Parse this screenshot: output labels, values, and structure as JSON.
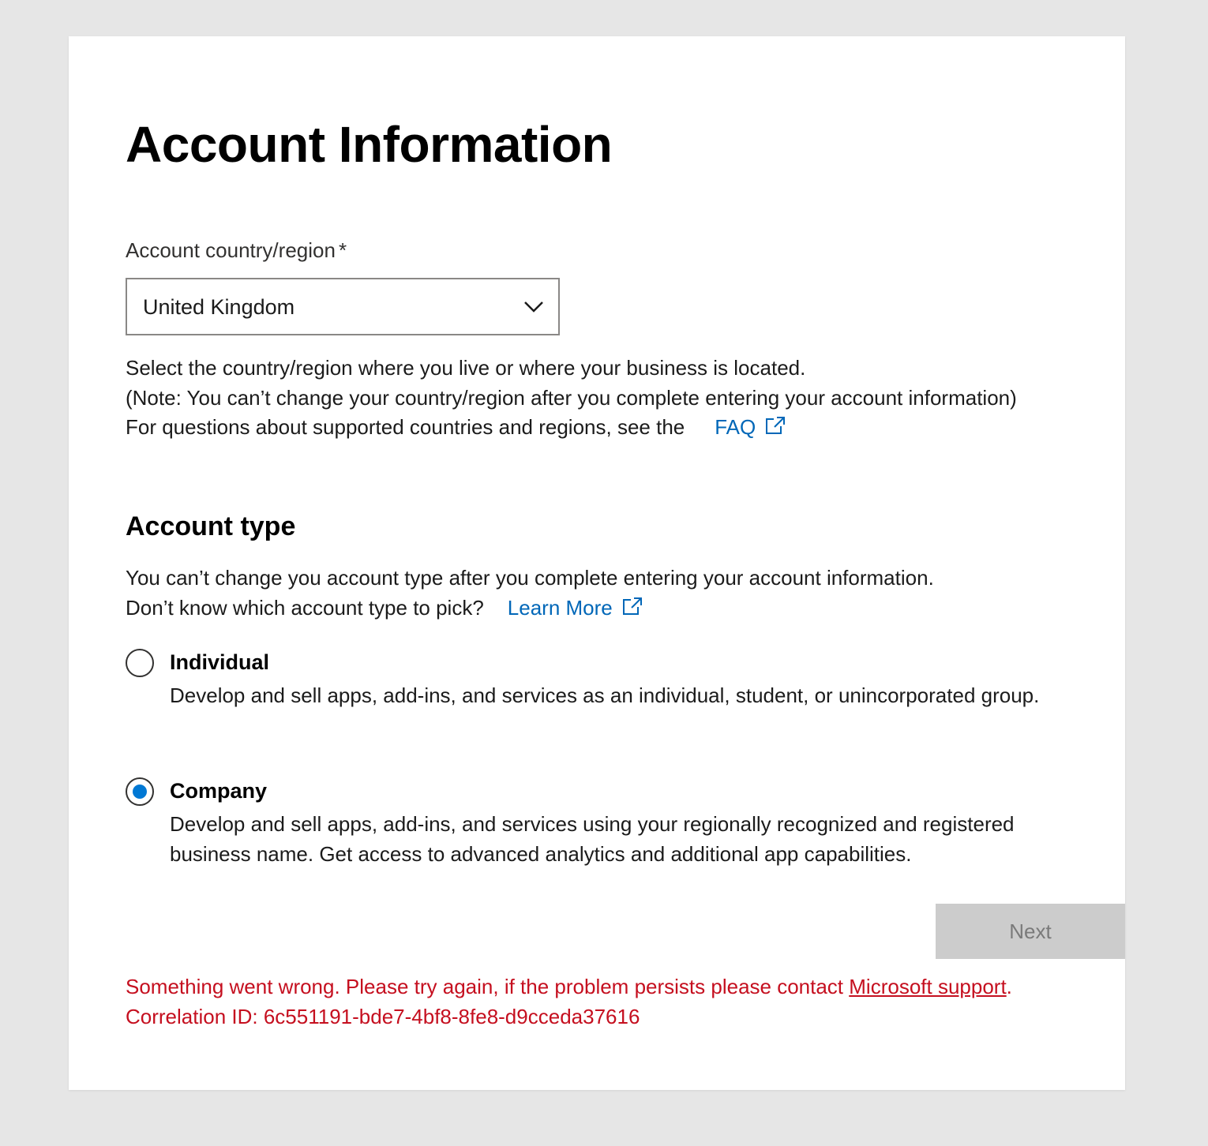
{
  "page": {
    "title": "Account Information"
  },
  "country": {
    "label": "Account country/region",
    "required_mark": "*",
    "selected_value": "United Kingdom",
    "help_line1": "Select the country/region where you live or where your business is located.",
    "help_line2": "(Note: You can’t change your country/region after you complete entering your account information)",
    "faq_prefix": "For questions about supported countries and regions, see the",
    "faq_link": "FAQ"
  },
  "account_type": {
    "heading": "Account type",
    "help_line1": "You can’t change you account type after you complete entering your account information.",
    "help_line2": "Don’t know which account type to pick?",
    "learn_more_link": "Learn More",
    "options": [
      {
        "title": "Individual",
        "description": "Develop and sell apps, add-ins, and services as an individual, student, or unincorporated group.",
        "selected": false
      },
      {
        "title": "Company",
        "description": "Develop and sell apps, add-ins, and services using your regionally recognized and registered business name. Get access to advanced analytics and additional app capabilities.",
        "selected": true
      }
    ]
  },
  "actions": {
    "next_label": "Next",
    "next_disabled": true
  },
  "error": {
    "message_prefix": "Something went wrong. Please try again, if the problem persists please contact ",
    "link_text": "Microsoft support",
    "message_suffix": ". Correlation ID: 6c551191-bde7-4bf8-8fe8-d9cceda37616"
  },
  "colors": {
    "background": "#e6e6e6",
    "link": "#0067b8",
    "radio_selected": "#0078d4",
    "error": "#c50f1f",
    "button_disabled_bg": "#cccccc",
    "button_disabled_text": "#7a7a7a"
  },
  "icons": {
    "dropdown": "chevron-down-icon",
    "external_link": "external-link-icon"
  }
}
